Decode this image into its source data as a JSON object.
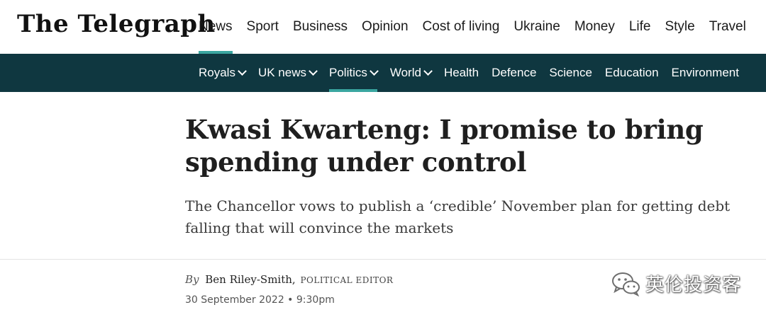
{
  "header": {
    "logo": "The Telegraph",
    "primary_nav": [
      {
        "label": "News",
        "active": true
      },
      {
        "label": "Sport"
      },
      {
        "label": "Business"
      },
      {
        "label": "Opinion"
      },
      {
        "label": "Cost of living"
      },
      {
        "label": "Ukraine"
      },
      {
        "label": "Money"
      },
      {
        "label": "Life"
      },
      {
        "label": "Style"
      },
      {
        "label": "Travel"
      }
    ],
    "secondary_nav": [
      {
        "label": "Royals",
        "dropdown": true
      },
      {
        "label": "UK news",
        "dropdown": true
      },
      {
        "label": "Politics",
        "dropdown": true,
        "active": true
      },
      {
        "label": "World",
        "dropdown": true
      },
      {
        "label": "Health"
      },
      {
        "label": "Defence"
      },
      {
        "label": "Science"
      },
      {
        "label": "Education"
      },
      {
        "label": "Environment"
      }
    ]
  },
  "article": {
    "headline": "Kwasi Kwarteng: I promise to bring spending under control",
    "standfirst": "The Chancellor vows to publish a ‘credible’ November plan for getting debt falling that will convince the markets",
    "byline_prefix": "By",
    "author": "Ben Riley-Smith,",
    "author_role": "POLITICAL EDITOR",
    "date": "30 September 2022 • 9:30pm"
  },
  "watermark": {
    "text": "英伦投资客",
    "icon": "wechat-icon"
  },
  "colors": {
    "nav_bg": "#0f3740",
    "accent": "#3aa6a0"
  }
}
